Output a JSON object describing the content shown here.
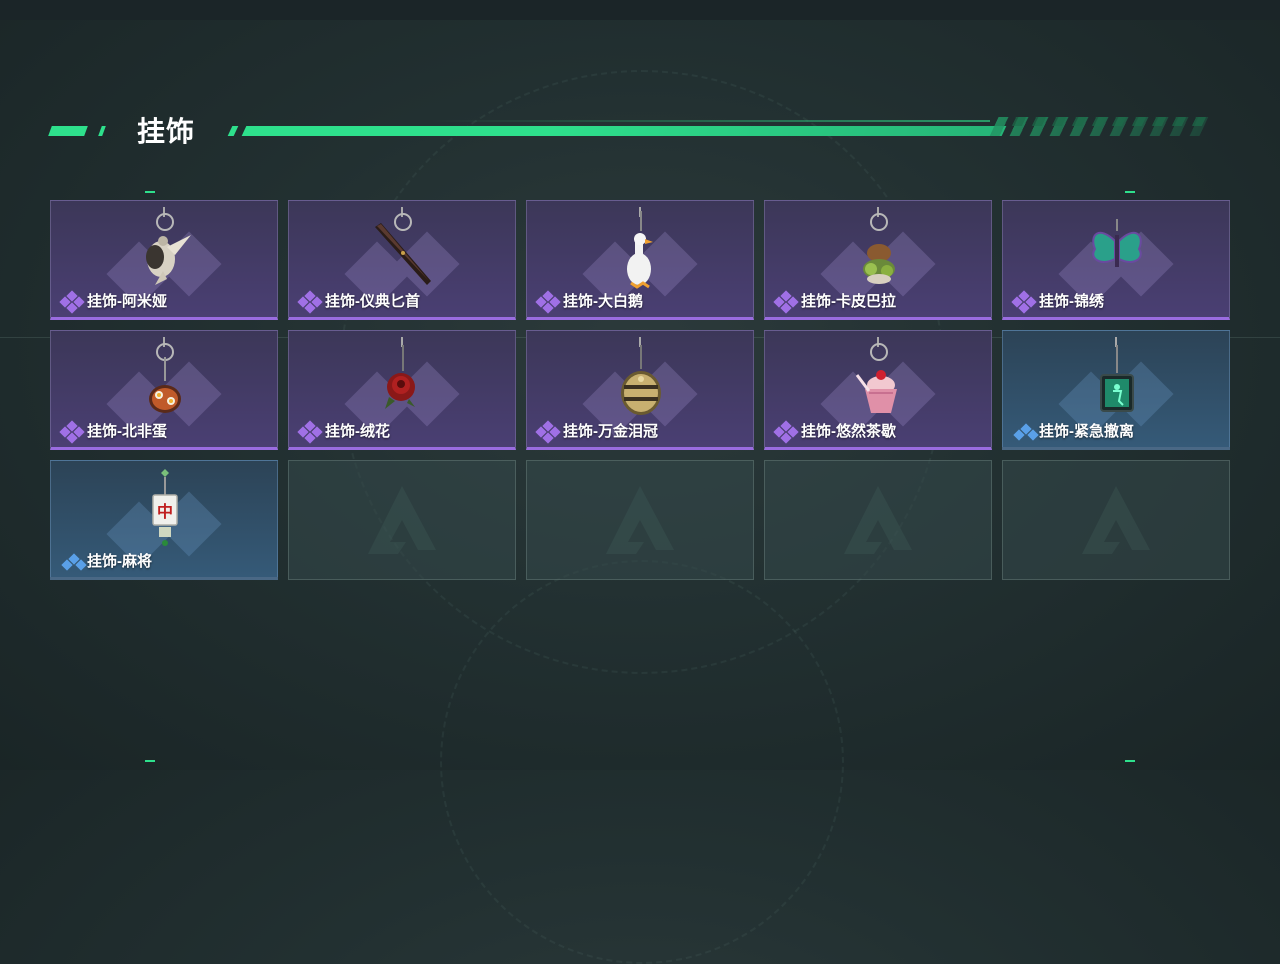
{
  "section": {
    "title": "挂饰"
  },
  "items": [
    {
      "label": "挂饰-阿米娅",
      "rarity": "purple",
      "icon": "amiya-rabbit-charm-icon"
    },
    {
      "label": "挂饰-仪典匕首",
      "rarity": "purple",
      "icon": "ceremonial-dagger-charm-icon"
    },
    {
      "label": "挂饰-大白鹅",
      "rarity": "purple",
      "icon": "white-goose-charm-icon"
    },
    {
      "label": "挂饰-卡皮巴拉",
      "rarity": "purple",
      "icon": "capybara-charm-icon"
    },
    {
      "label": "挂饰-锦绣",
      "rarity": "purple",
      "icon": "butterfly-charm-icon"
    },
    {
      "label": "挂饰-北非蛋",
      "rarity": "purple",
      "icon": "shakshuka-charm-icon"
    },
    {
      "label": "挂饰-绒花",
      "rarity": "purple",
      "icon": "rose-charm-icon"
    },
    {
      "label": "挂饰-万金泪冠",
      "rarity": "purple",
      "icon": "golden-crown-charm-icon"
    },
    {
      "label": "挂饰-悠然茶歇",
      "rarity": "purple",
      "icon": "cupcake-charm-icon"
    },
    {
      "label": "挂饰-紧急撤离",
      "rarity": "blue",
      "icon": "emergency-exit-charm-icon"
    },
    {
      "label": "挂饰-麻将",
      "rarity": "blue",
      "icon": "mahjong-tile-charm-icon",
      "tile_char": "中"
    }
  ],
  "empty_slots": 4,
  "colors": {
    "accent_green": "#2ee08c",
    "rarity_purple": "#9a6ce0",
    "rarity_blue": "#4d92d8"
  }
}
